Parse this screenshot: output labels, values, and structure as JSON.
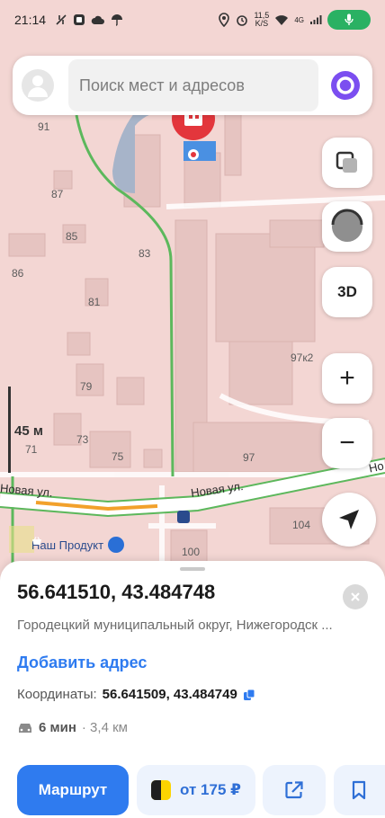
{
  "status_bar": {
    "time": "21:14",
    "speed_value": "11,5",
    "speed_unit": "K/S",
    "network": "4G"
  },
  "search": {
    "placeholder": "Поиск мест и адресов"
  },
  "map": {
    "scale_label": "45 м",
    "button_3d": "3D",
    "zoom_in": "+",
    "zoom_out": "−",
    "streets": {
      "novaya_left": "Новая ул.",
      "novaya_center": "Новая ул.",
      "novaya_right": "Но"
    },
    "houses": {
      "h91": "91",
      "h87": "87",
      "h85": "85",
      "h83": "83",
      "h86": "86",
      "h81": "81",
      "h79": "79",
      "h73": "73",
      "h71": "71",
      "h75": "75",
      "h97k2": "97к2",
      "h97": "97",
      "h104": "104",
      "h100": "100"
    },
    "poi_shop": "Наш Продукт"
  },
  "sheet": {
    "title_coords": "56.641510, 43.484748",
    "address": "Городецкий муниципальный округ, Нижегородск ...",
    "add_address": "Добавить адрес",
    "coords_label": "Координаты:",
    "coords_value": "56.641509, 43.484749",
    "drive_time": "6 мин",
    "drive_distance": "· 3,4 км",
    "route_label": "Маршрут",
    "taxi_label": "от 175 ₽"
  },
  "colors": {
    "accent_blue": "#2f7bef",
    "map_pink": "#f3d6d3",
    "road_green": "#5cb85c",
    "pin_red": "#e3363c",
    "alice_purple": "#7b4ef0",
    "taxi_yellow": "#fcd400"
  }
}
